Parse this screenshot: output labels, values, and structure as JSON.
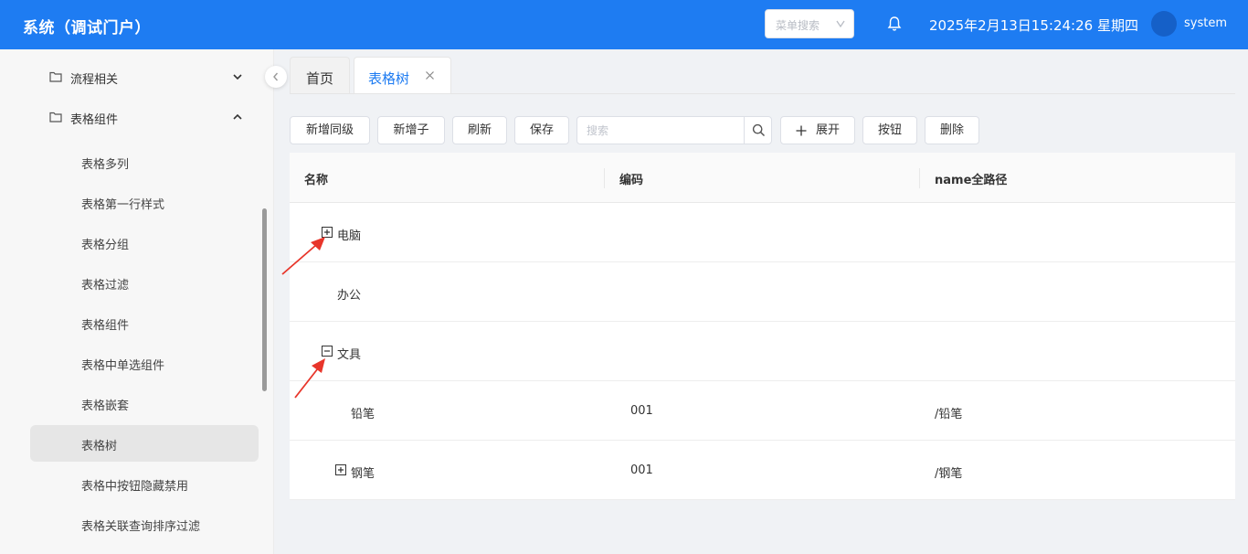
{
  "header": {
    "title": "系统（调试门户）",
    "menu_search_placeholder": "菜单搜索",
    "datetime": "2025年2月13日15:24:26 星期四",
    "username": "system"
  },
  "sidebar": {
    "folders": [
      {
        "label": "流程相关",
        "expanded": false
      },
      {
        "label": "表格组件",
        "expanded": true
      }
    ],
    "items": [
      {
        "label": "表格多列"
      },
      {
        "label": "表格第一行样式"
      },
      {
        "label": "表格分组"
      },
      {
        "label": "表格过滤"
      },
      {
        "label": "表格组件"
      },
      {
        "label": "表格中单选组件"
      },
      {
        "label": "表格嵌套"
      },
      {
        "label": "表格树",
        "active": true
      },
      {
        "label": "表格中按钮隐藏禁用"
      },
      {
        "label": "表格关联查询排序过滤"
      }
    ]
  },
  "tabs": [
    {
      "label": "首页",
      "active": false
    },
    {
      "label": "表格树",
      "active": true,
      "closable": true
    }
  ],
  "toolbar": {
    "add_sibling": "新增同级",
    "add_child": "新增子",
    "refresh": "刷新",
    "save": "保存",
    "search_placeholder": "搜索",
    "expand": "展开",
    "button": "按钮",
    "delete": "删除"
  },
  "table": {
    "columns": [
      "名称",
      "编码",
      "name全路径"
    ],
    "rows": [
      {
        "name": "电脑",
        "code": "",
        "path": "",
        "level": 0,
        "toggle": "plus"
      },
      {
        "name": "办公",
        "code": "",
        "path": "",
        "level": 0,
        "toggle": "none"
      },
      {
        "name": "文具",
        "code": "",
        "path": "",
        "level": 0,
        "toggle": "minus"
      },
      {
        "name": "铅笔",
        "code": "001",
        "path": "/铅笔",
        "level": 1,
        "toggle": "none"
      },
      {
        "name": "钢笔",
        "code": "001",
        "path": "/钢笔",
        "level": 1,
        "toggle": "plus"
      }
    ]
  },
  "colors": {
    "header_bg": "#1e7cf2",
    "accent": "#1e7cf2",
    "annotation_arrow": "#e8352a"
  },
  "icons": [
    "bell-icon",
    "folder-icon",
    "chevron-down-icon",
    "chevron-up-icon",
    "chevron-left-icon",
    "close-icon",
    "search-icon",
    "plus-icon",
    "expand-plus-icon",
    "collapse-minus-icon"
  ]
}
